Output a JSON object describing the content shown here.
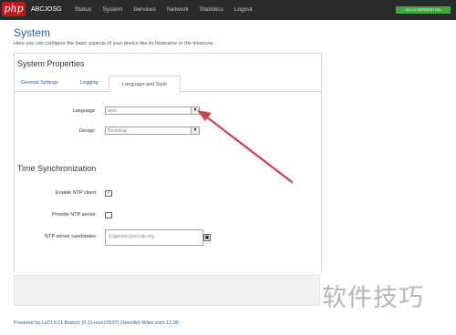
{
  "branding": {
    "logo_text": "php",
    "hostname": "ABCJOSG"
  },
  "nav": {
    "items": [
      "Status",
      "System",
      "Services",
      "Network",
      "Statistics",
      "Logout"
    ]
  },
  "autorefresh": "AUTO REFRESH ON",
  "page": {
    "title": "System",
    "description": "Here you can configure the basic aspects of your device like its hostname or the timezone."
  },
  "system_properties": {
    "title": "System Properties",
    "tabs": [
      "General Settings",
      "Logging",
      "Language and Style"
    ],
    "active_tab": "Language and Style",
    "language": {
      "label": "Language",
      "value": "auto"
    },
    "design": {
      "label": "Design",
      "value": "Bootstrap"
    }
  },
  "time_sync": {
    "title": "Time Synchronization",
    "enable_ntp": {
      "label": "Enable NTP client",
      "checked": true,
      "mark": "✓"
    },
    "provide_ntp": {
      "label": "Provide NTP server",
      "checked": false
    },
    "ntp_candidates": {
      "label": "NTP server candidates",
      "value": "0.openwrt.pool.ntp.org"
    }
  },
  "footer": {
    "text": "Powered by LuCI 0.11 Branch (0.11+svn10537) OpenWrt Wiwz.com 12.09"
  },
  "watermark": "软件技巧",
  "colors": {
    "accent": "#2a5fa5",
    "topbar": "#2b2b2b",
    "arrow": "#c8434f",
    "badge": "#3fa63f"
  }
}
